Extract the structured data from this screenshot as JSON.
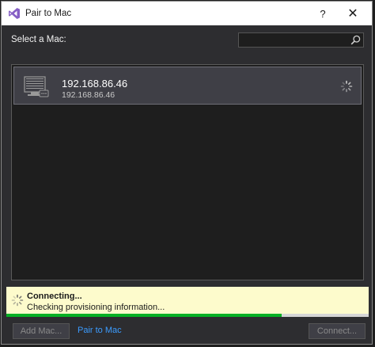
{
  "window": {
    "title": "Pair to Mac",
    "help_label": "?",
    "close_label": "✕"
  },
  "select_label": "Select a Mac:",
  "search": {
    "value": "",
    "placeholder": ""
  },
  "macs": [
    {
      "name": "192.168.86.46",
      "address": "192.168.86.46",
      "state": "connecting"
    }
  ],
  "status": {
    "title": "Connecting...",
    "detail": "Checking provisioning information...",
    "progress_fraction": 0.76
  },
  "buttons": {
    "add_mac": "Add Mac...",
    "connect": "Connect..."
  },
  "link": {
    "pair_to_mac": "Pair to Mac"
  },
  "colors": {
    "accent_link": "#3c9cff",
    "status_background": "#fdfbcc",
    "progress": "#06b025",
    "vs_purple": "#865fc5"
  }
}
